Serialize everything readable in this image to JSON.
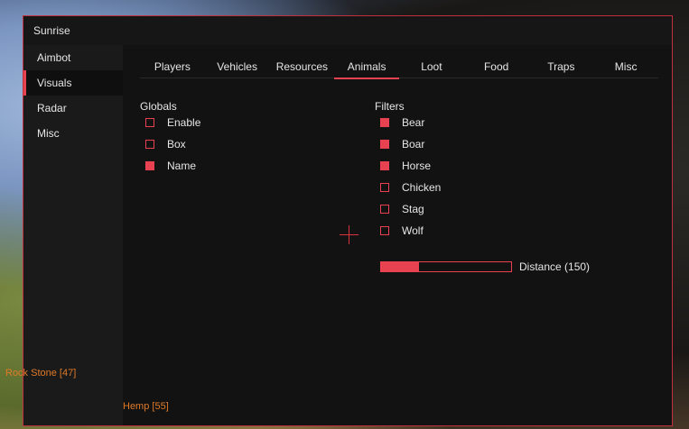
{
  "window": {
    "title": "Sunrise"
  },
  "sidebar": {
    "items": [
      {
        "label": "Aimbot",
        "active": false
      },
      {
        "label": "Visuals",
        "active": true
      },
      {
        "label": "Radar",
        "active": false
      },
      {
        "label": "Misc",
        "active": false
      }
    ]
  },
  "tabs": [
    {
      "label": "Players",
      "active": false
    },
    {
      "label": "Vehicles",
      "active": false
    },
    {
      "label": "Resources",
      "active": false
    },
    {
      "label": "Animals",
      "active": true
    },
    {
      "label": "Loot",
      "active": false
    },
    {
      "label": "Food",
      "active": false
    },
    {
      "label": "Traps",
      "active": false
    },
    {
      "label": "Misc",
      "active": false
    }
  ],
  "globals": {
    "title": "Globals",
    "options": [
      {
        "label": "Enable",
        "checked": false
      },
      {
        "label": "Box",
        "checked": false
      },
      {
        "label": "Name",
        "checked": true
      }
    ]
  },
  "filters": {
    "title": "Filters",
    "options": [
      {
        "label": "Bear",
        "checked": true
      },
      {
        "label": "Boar",
        "checked": true
      },
      {
        "label": "Horse",
        "checked": true
      },
      {
        "label": "Chicken",
        "checked": false
      },
      {
        "label": "Stag",
        "checked": false
      },
      {
        "label": "Wolf",
        "checked": false
      }
    ],
    "distance": {
      "label": "Distance (150)",
      "value": 150,
      "fraction": 0.29
    }
  },
  "overlay": {
    "esp_labels": [
      "Rock Stone [47]",
      "Hemp [55]"
    ]
  },
  "colors": {
    "accent": "#e8414f",
    "esp_text": "#e07a28",
    "panel": "#161616"
  }
}
